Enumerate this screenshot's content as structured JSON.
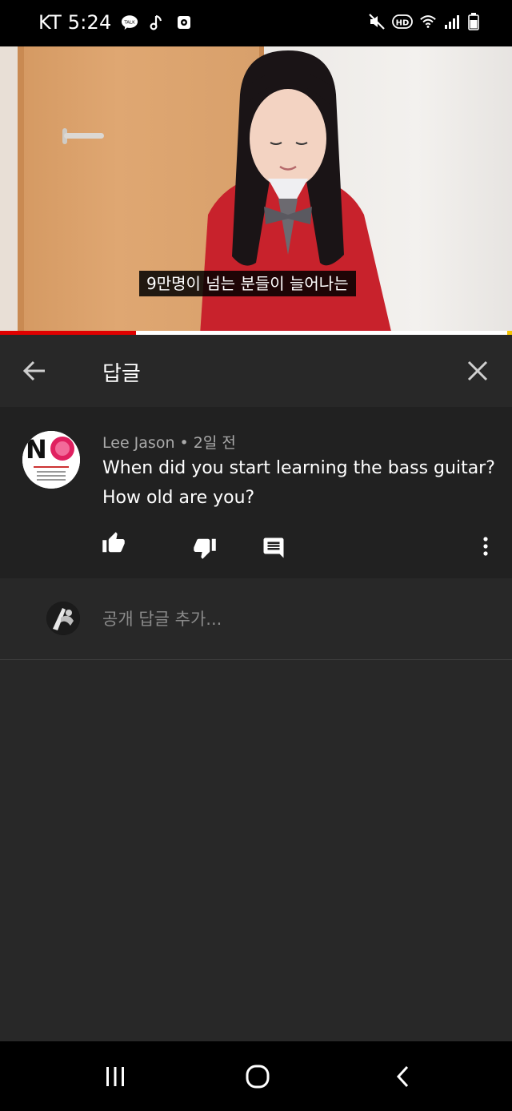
{
  "status_bar": {
    "carrier_time": "KT 5:24",
    "left_icons": [
      "kakaotalk-icon",
      "music-note-icon",
      "screen-record-icon"
    ],
    "hd_label": "HD",
    "right_icons": [
      "mute-icon",
      "hd-voice-icon",
      "wifi-icon",
      "signal-icon",
      "battery-icon"
    ]
  },
  "video": {
    "subtitle": "9만명이 넘는 분들이 늘어나는",
    "progress": 0.265,
    "colors": {
      "progress": "#e00000",
      "track": "#ffffff"
    }
  },
  "replies_header": {
    "title": "답글"
  },
  "comment": {
    "author": "Lee Jason",
    "time": "2일 전",
    "text_line1": "When did you start learning the bass guitar?",
    "text_line2": "How old are you?",
    "avatar_letter": "N",
    "actions": [
      "like",
      "dislike",
      "reply",
      "more"
    ]
  },
  "add_reply": {
    "placeholder": "공개 답글 추가..."
  },
  "nav_bar": {
    "buttons": [
      "recents",
      "home",
      "back"
    ]
  }
}
